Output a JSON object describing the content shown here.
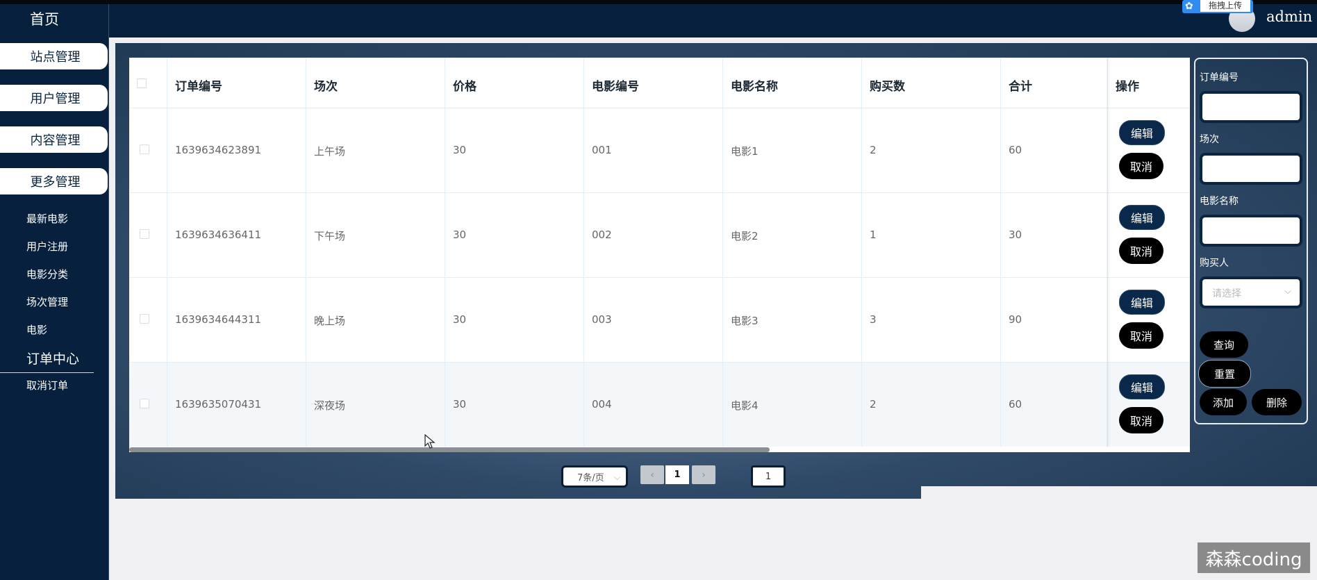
{
  "sidebar": {
    "home": "首页",
    "main_menu": [
      "站点管理",
      "用户管理",
      "内容管理",
      "更多管理"
    ],
    "sub_items": [
      "最新电影",
      "用户注册",
      "电影分类",
      "场次管理",
      "电影"
    ],
    "section": "订单中心",
    "section_items": [
      "取消订单"
    ]
  },
  "header": {
    "user": "admin",
    "upload_label": "拖拽上传"
  },
  "table": {
    "columns": [
      "订单编号",
      "场次",
      "价格",
      "电影编号",
      "电影名称",
      "购买数",
      "合计",
      "操作"
    ],
    "rows": [
      [
        "1639634623891",
        "上午场",
        "30",
        "001",
        "电影1",
        "2",
        "60"
      ],
      [
        "1639634636411",
        "下午场",
        "30",
        "002",
        "电影2",
        "1",
        "30"
      ],
      [
        "1639634644311",
        "晚上场",
        "30",
        "003",
        "电影3",
        "3",
        "90"
      ],
      [
        "1639635070431",
        "深夜场",
        "30",
        "004",
        "电影4",
        "2",
        "60"
      ]
    ],
    "edit_label": "编辑",
    "cancel_label": "取消"
  },
  "pagination": {
    "page_size": "7条/页",
    "current_page": "1",
    "prev": "‹",
    "next": "›",
    "jump_value": "1"
  },
  "search": {
    "order_no_label": "订单编号",
    "session_label": "场次",
    "movie_name_label": "电影名称",
    "buyer_label": "购买人",
    "buyer_placeholder": "请选择",
    "query_label": "查询",
    "reset_label": "重置",
    "add_label": "添加",
    "delete_label": "删除"
  },
  "watermark": "森森coding"
}
